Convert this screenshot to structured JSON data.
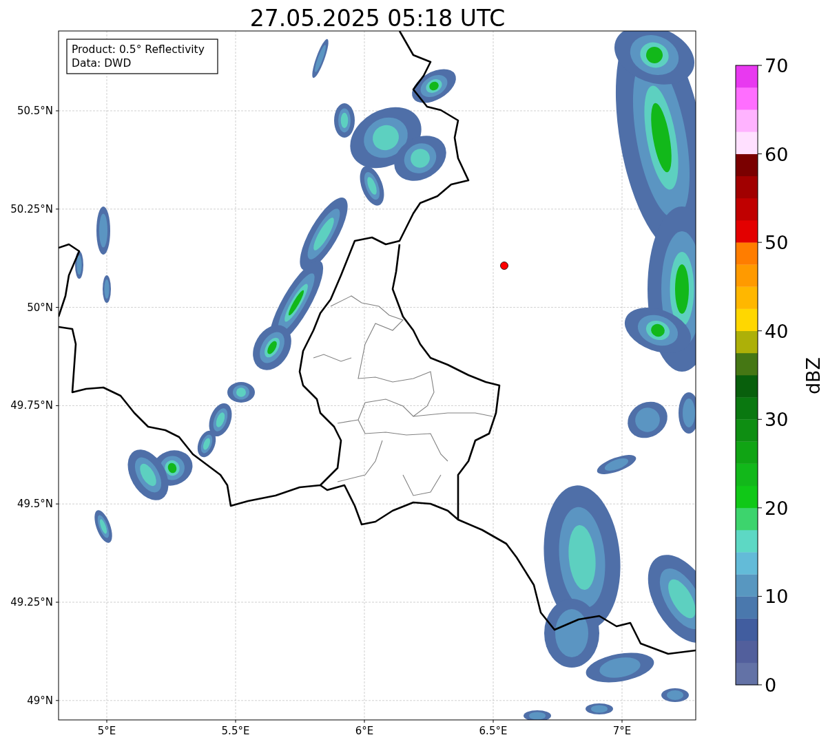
{
  "title": "27.05.2025 05:18 UTC",
  "legend": [
    "Product: 0.5° Reflectivity",
    "Data: DWD"
  ],
  "map": {
    "yticks": [
      "50.5°N",
      "50.25°N",
      "50°N",
      "49.75°N",
      "49.5°N",
      "49.25°N",
      "49°N"
    ],
    "xticks": [
      "5°E",
      "5.5°E",
      "6°E",
      "6.5°E",
      "7°E"
    ]
  },
  "colorbar": {
    "label": "dBZ",
    "ticks": [
      "70",
      "60",
      "50",
      "40",
      "30",
      "20",
      "10",
      "0"
    ],
    "segments": [
      {
        "color": "#6372a6"
      },
      {
        "color": "#525f9c"
      },
      {
        "color": "#415d9f"
      },
      {
        "color": "#4a78ad"
      },
      {
        "color": "#5897c0"
      },
      {
        "color": "#63bbd8"
      },
      {
        "color": "#5dd8c4"
      },
      {
        "color": "#3dd46d"
      },
      {
        "color": "#10c817"
      },
      {
        "color": "#12b81a"
      },
      {
        "color": "#10a414"
      },
      {
        "color": "#0e8e12"
      },
      {
        "color": "#0a7810"
      },
      {
        "color": "#085f0c"
      },
      {
        "color": "#457714"
      },
      {
        "color": "#adb008"
      },
      {
        "color": "#ffd700"
      },
      {
        "color": "#ffb700"
      },
      {
        "color": "#ff9a00"
      },
      {
        "color": "#ff7d00"
      },
      {
        "color": "#e30000"
      },
      {
        "color": "#c00000"
      },
      {
        "color": "#a10000"
      },
      {
        "color": "#7a0000"
      },
      {
        "color": "#ffe0ff"
      },
      {
        "color": "#ffb3ff"
      },
      {
        "color": "#ff6eff"
      },
      {
        "color": "#e839f0"
      }
    ]
  }
}
